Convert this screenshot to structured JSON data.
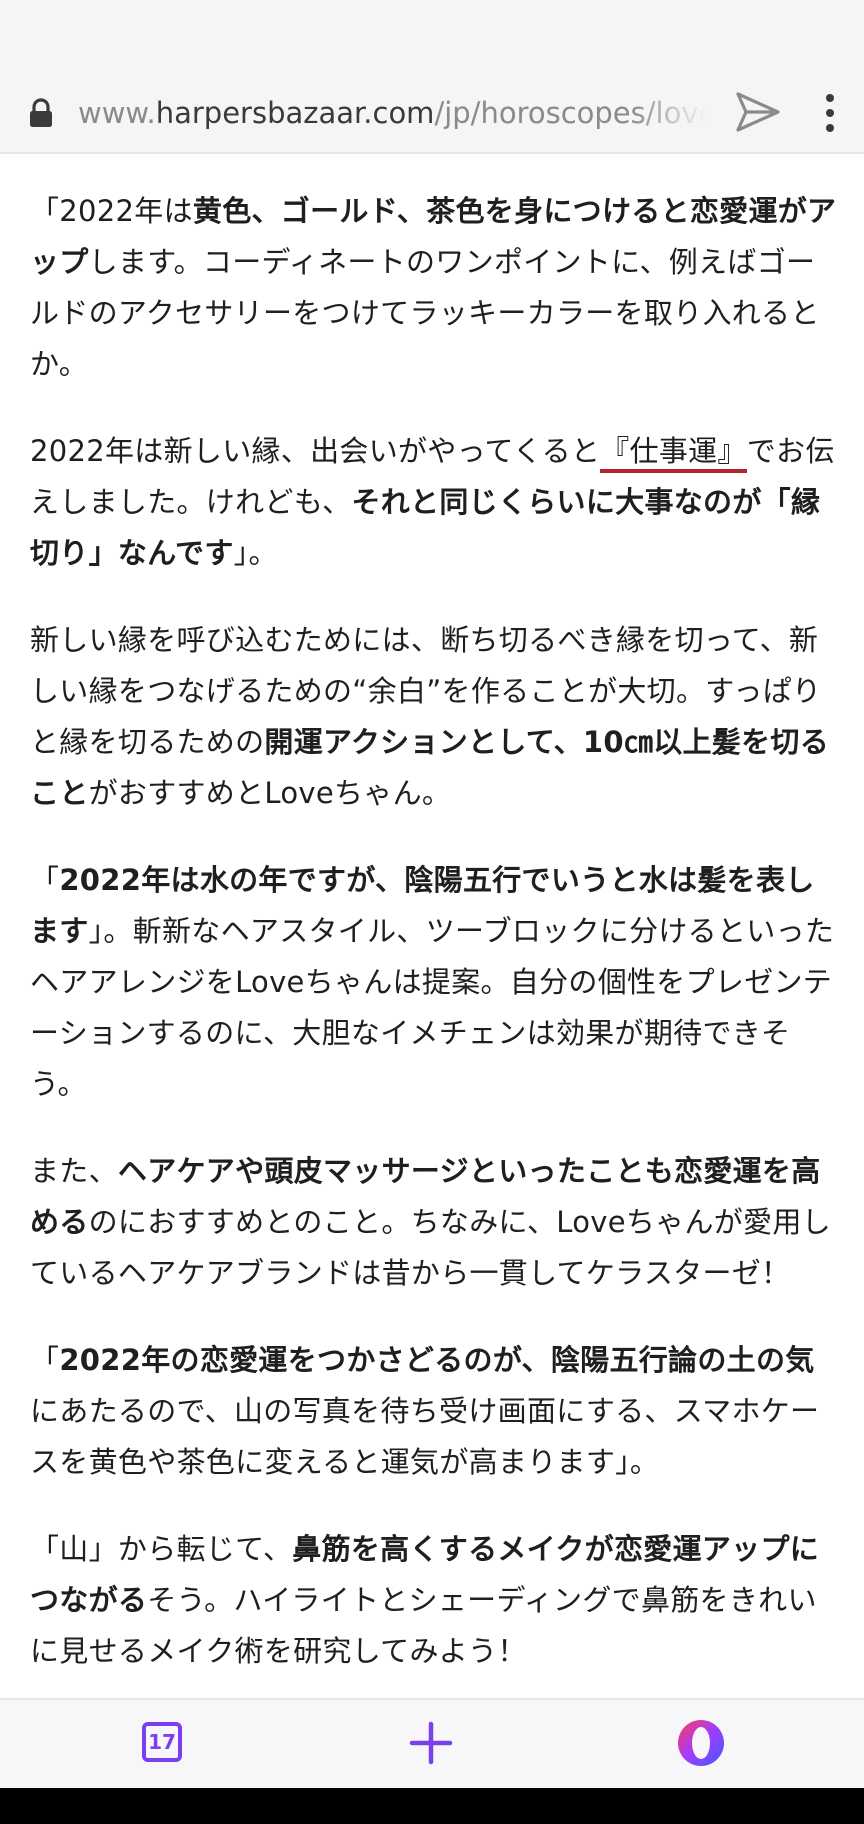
{
  "browser": {
    "url_scheme": "www.",
    "url_domain": "harpersbazaar.com",
    "url_path": "/jp/horoscopes/love-m",
    "icons": {
      "lock": "lock-icon",
      "send": "send-icon",
      "menu": "kebab-menu-icon"
    }
  },
  "article": {
    "p1": {
      "a": "「2022年は",
      "b": "黄色、ゴールド、茶色を身につけると恋愛運がアップ",
      "c": "します。コーディネートのワンポイントに、例えばゴールドのアクセサリーをつけてラッキーカラーを取り入れるとか。"
    },
    "p2": {
      "a": "2022年は新しい縁、出会いがやってくると",
      "link": "『仕事運』",
      "c": "でお伝えしました。けれども、",
      "d": "それと同じくらいに大事なのが「縁切り」なんです",
      "e": "」。"
    },
    "p3": {
      "a": "新しい縁を呼び込むためには、断ち切るべき縁を切って、新しい縁をつなげるための“余白”を作ることが大切。すっぱりと縁を切るための",
      "b": "開運アクションとして、10㎝以上髪を切ること",
      "c": "がおすすめとLoveちゃん。"
    },
    "p4": {
      "a": "「",
      "b": "2022年は水の年ですが、陰陽五行でいうと水は髪を表します",
      "c": "」。斬新なヘアスタイル、ツーブロックに分けるといったヘアアレンジをLoveちゃんは提案。自分の個性をプレゼンテーションするのに、大胆なイメチェンは効果が期待できそう。"
    },
    "p5": {
      "a": "また、",
      "b": "ヘアケアや頭皮マッサージといったことも恋愛運を高める",
      "c": "のにおすすめとのこと。ちなみに、Loveちゃんが愛用しているヘアケアブランドは昔から一貫してケラスターゼ！"
    },
    "p6": {
      "a": "「",
      "b": "2022年の恋愛運をつかさどるのが、陰陽五行論の土の気",
      "c": "にあたるので、山の写真を待ち受け画面にする、スマホケースを黄色や茶色に変えると運気が高まります」。"
    },
    "p7": {
      "a": "「山」から転じて、",
      "b": "鼻筋を高くするメイクが恋愛運アップにつながる",
      "c": "そう。ハイライトとシェーディングで鼻筋をきれいに見せるメイク術を研究してみよう！"
    }
  },
  "toolbar": {
    "tabs_count": "17",
    "icons": {
      "tabs": "tabs-icon",
      "add": "plus-icon",
      "opera": "opera-logo-icon"
    }
  },
  "colors": {
    "accent": "#7a3ff0",
    "link_underline": "#b3262c",
    "url_muted": "#8a8a8a",
    "bar_background": "#f5f5f7"
  }
}
